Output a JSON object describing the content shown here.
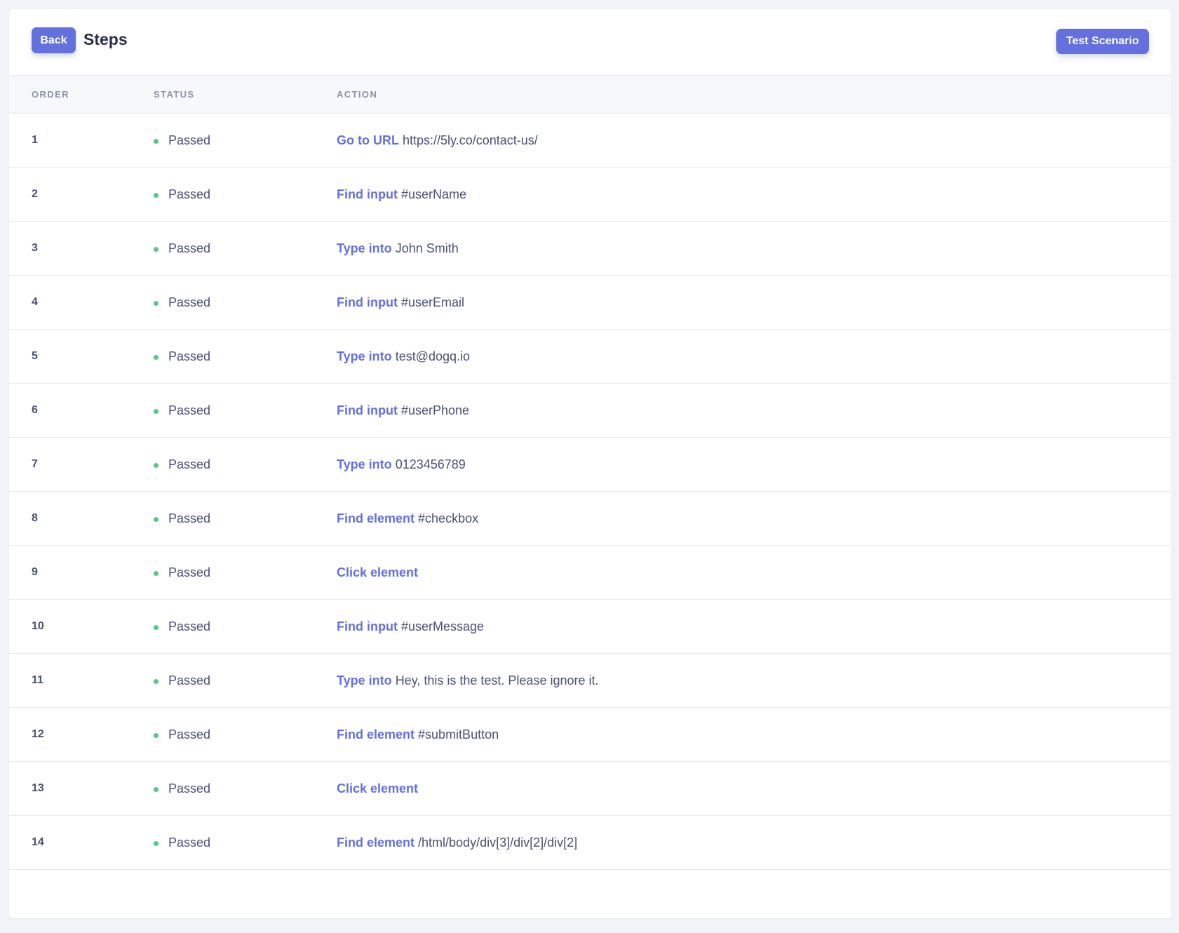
{
  "header": {
    "back_label": "Back",
    "title": "Steps",
    "test_scenario_label": "Test Scenario"
  },
  "table": {
    "columns": [
      "ORDER",
      "STATUS",
      "ACTION"
    ],
    "rows": [
      {
        "order": "1",
        "status": "Passed",
        "verb": "Go to URL",
        "target": "https://5ly.co/contact-us/"
      },
      {
        "order": "2",
        "status": "Passed",
        "verb": "Find input",
        "target": "#userName"
      },
      {
        "order": "3",
        "status": "Passed",
        "verb": "Type into",
        "target": "John Smith"
      },
      {
        "order": "4",
        "status": "Passed",
        "verb": "Find input",
        "target": "#userEmail"
      },
      {
        "order": "5",
        "status": "Passed",
        "verb": "Type into",
        "target": "test@dogq.io"
      },
      {
        "order": "6",
        "status": "Passed",
        "verb": "Find input",
        "target": "#userPhone"
      },
      {
        "order": "7",
        "status": "Passed",
        "verb": "Type into",
        "target": "0123456789"
      },
      {
        "order": "8",
        "status": "Passed",
        "verb": "Find element",
        "target": "#checkbox"
      },
      {
        "order": "9",
        "status": "Passed",
        "verb": "Click element",
        "target": ""
      },
      {
        "order": "10",
        "status": "Passed",
        "verb": "Find input",
        "target": "#userMessage"
      },
      {
        "order": "11",
        "status": "Passed",
        "verb": "Type into",
        "target": "Hey, this is the test. Please ignore it."
      },
      {
        "order": "12",
        "status": "Passed",
        "verb": "Find element",
        "target": "#submitButton"
      },
      {
        "order": "13",
        "status": "Passed",
        "verb": "Click element",
        "target": ""
      },
      {
        "order": "14",
        "status": "Passed",
        "verb": "Find element",
        "target": "/html/body/div[3]/div[2]/div[2]"
      }
    ]
  },
  "colors": {
    "accent": "#6370de",
    "passed": "#56c78b",
    "text": "#4a5072",
    "title": "#2b2d50",
    "header_text": "#8a94a6",
    "background": "#f1f3f9"
  },
  "icons": {
    "status_dot": "status-dot-icon"
  }
}
